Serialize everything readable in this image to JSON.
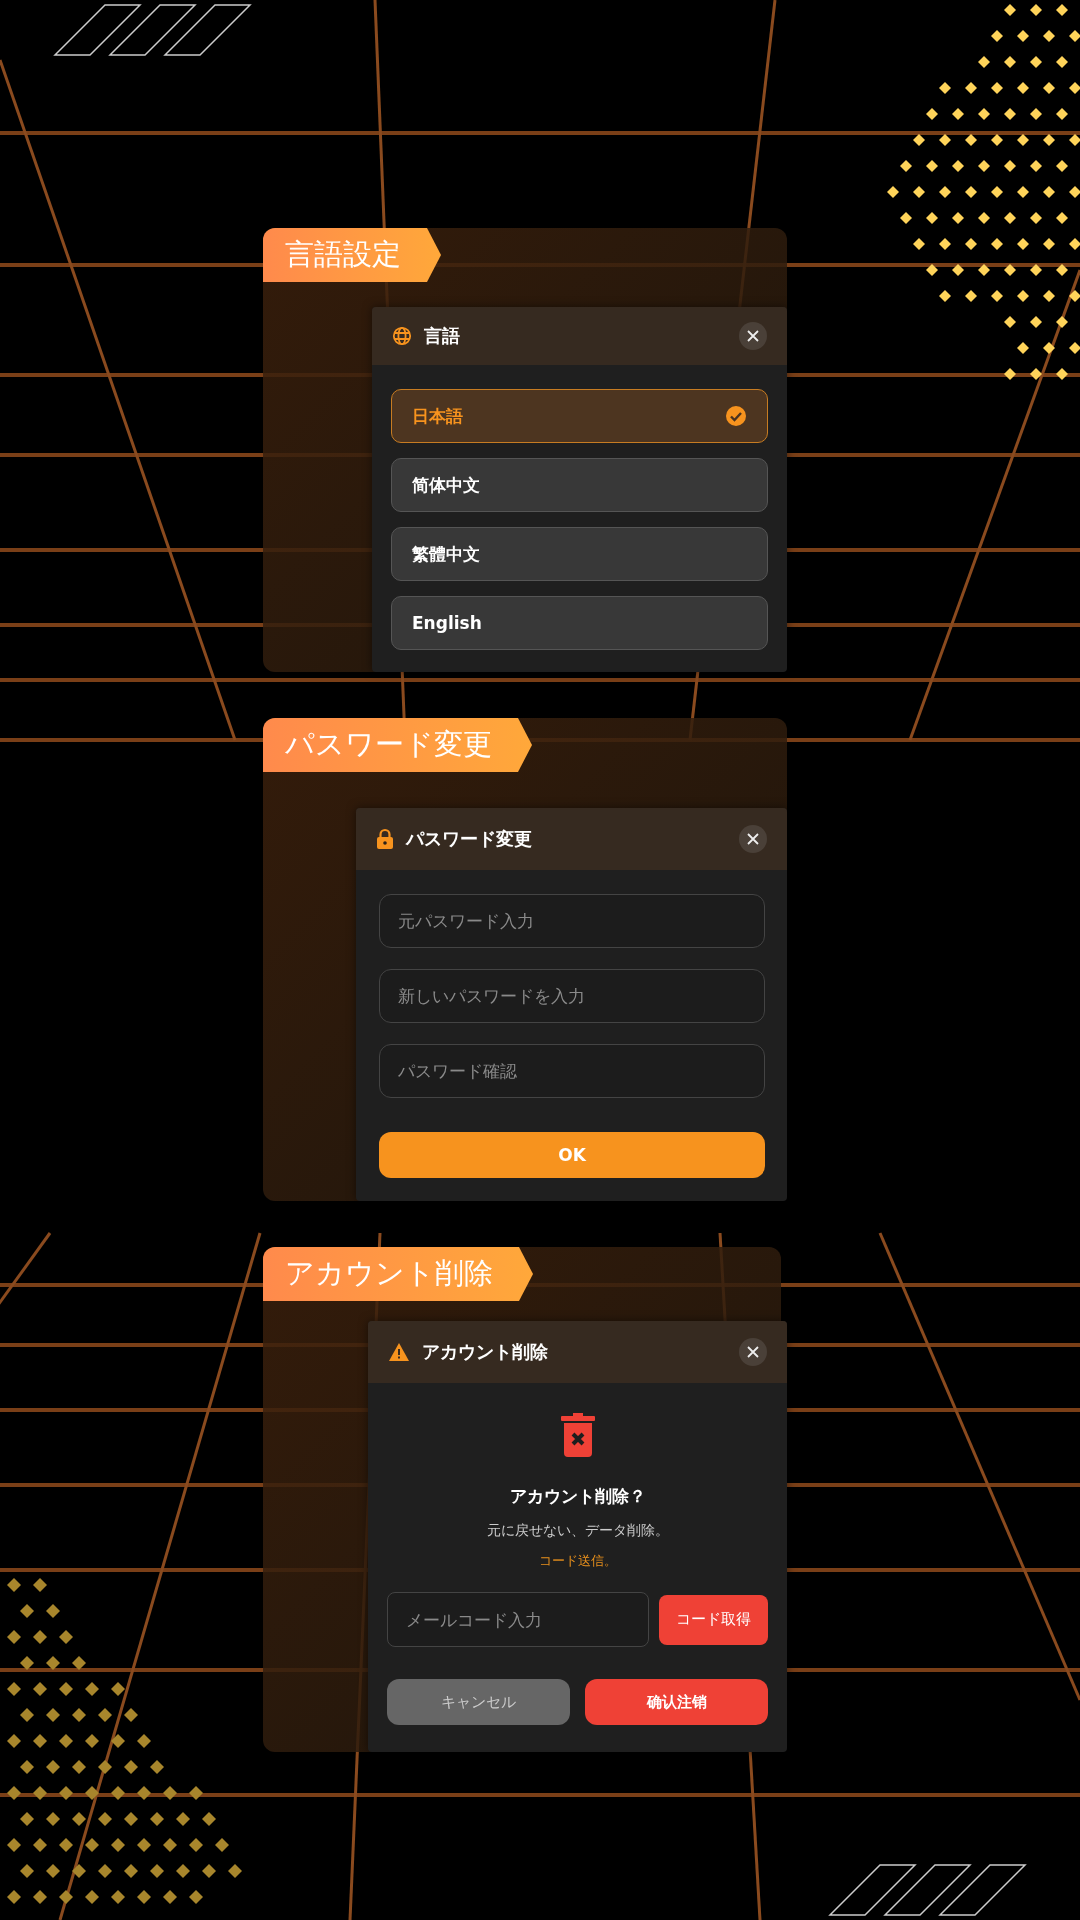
{
  "sections": [
    {
      "kind": "language",
      "tag": "言語設定",
      "dialog": {
        "title": "言語",
        "options": [
          {
            "label": "日本語",
            "selected": true
          },
          {
            "label": "简体中文",
            "selected": false
          },
          {
            "label": "繁體中文",
            "selected": false
          },
          {
            "label": "English",
            "selected": false
          }
        ]
      }
    },
    {
      "kind": "password",
      "tag": "パスワード変更",
      "dialog": {
        "title": "パスワード変更",
        "fields": [
          {
            "placeholder": "元パスワード入力"
          },
          {
            "placeholder": "新しいパスワードを入力"
          },
          {
            "placeholder": "パスワード確認"
          }
        ],
        "submit": "OK"
      }
    },
    {
      "kind": "delete",
      "tag": "アカウント削除",
      "dialog": {
        "title": "アカウント削除",
        "heading": "アカウント削除？",
        "message": "元に戻せない、データ削除。",
        "note": "コード送信。",
        "code_field": {
          "placeholder": "メールコード入力"
        },
        "code_button": "コード取得",
        "cancel": "キャンセル",
        "confirm": "确认注销"
      }
    }
  ]
}
